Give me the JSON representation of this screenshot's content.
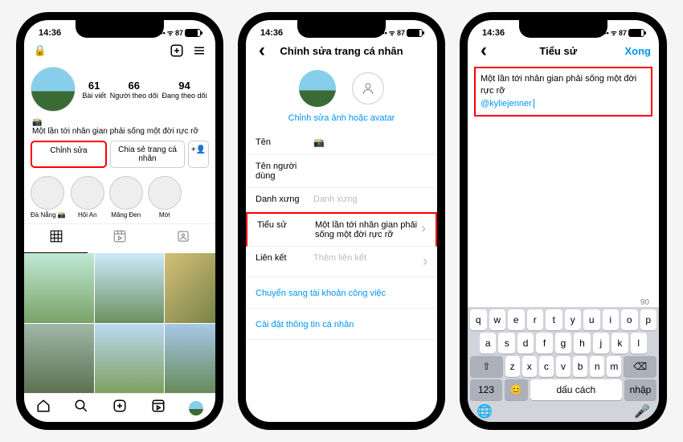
{
  "status": {
    "time": "14:36",
    "battery": "87"
  },
  "p1": {
    "stats": {
      "posts_n": "61",
      "posts_l": "Bài viết",
      "followers_n": "66",
      "followers_l": "Người theo dõi",
      "following_n": "94",
      "following_l": "Đang theo dõi"
    },
    "bio_emoji": "📸",
    "bio_text": "Một lần tới nhân gian phải sống một đời rực rỡ",
    "edit_btn": "Chỉnh sửa",
    "share_btn": "Chia sẻ trang cá nhân",
    "hl": [
      "Đà Nẵng 📸",
      "Hội An",
      "Măng Đen",
      "Mới"
    ]
  },
  "p2": {
    "title": "Chỉnh sửa trang cá nhân",
    "change_photo": "Chỉnh sửa ảnh hoặc avatar",
    "f_name": "Tên",
    "f_name_v": "📸",
    "f_user": "Tên người dùng",
    "f_pron": "Danh xưng",
    "f_pron_ph": "Danh xưng",
    "f_bio": "Tiểu sử",
    "f_bio_v": "Một lần tới nhân gian phải sống một đời rực rỡ",
    "f_link": "Liên kết",
    "f_link_ph": "Thêm liên kết",
    "switch": "Chuyển sang tài khoản công việc",
    "settings": "Cài đặt thông tin cá nhân"
  },
  "p3": {
    "title": "Tiểu sử",
    "done": "Xong",
    "text": "Một lần tới nhân gian phải sống một đời rực rỡ",
    "mention": "@kyliejenner",
    "count": "90",
    "kbd_r1": [
      "q",
      "w",
      "e",
      "r",
      "t",
      "y",
      "u",
      "i",
      "o",
      "p"
    ],
    "kbd_r2": [
      "a",
      "s",
      "d",
      "f",
      "g",
      "h",
      "j",
      "k",
      "l"
    ],
    "kbd_r3": [
      "z",
      "x",
      "c",
      "v",
      "b",
      "n",
      "m"
    ],
    "num": "123",
    "space": "dấu cách",
    "ret": "nhập"
  }
}
